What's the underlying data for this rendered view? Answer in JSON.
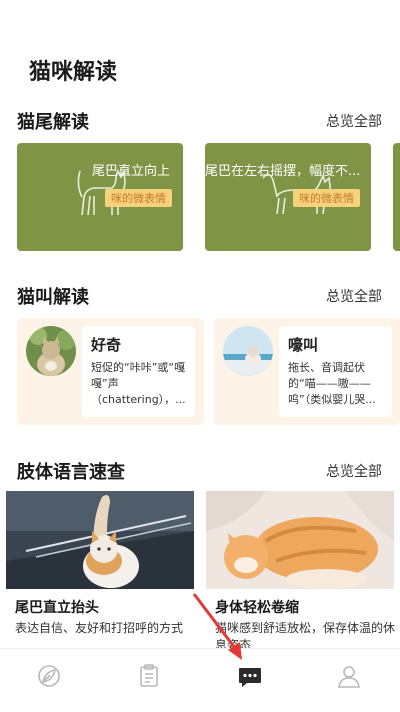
{
  "page_title": "猫咪解读",
  "sections": {
    "tail": {
      "title": "猫尾解读",
      "more": "总览全部"
    },
    "sound": {
      "title": "猫叫解读",
      "more": "总览全部"
    },
    "body": {
      "title": "肢体语言速查",
      "more": "总览全部"
    }
  },
  "tail_cards": [
    {
      "title": "尾巴直立向上",
      "badge": "咪的微表情"
    },
    {
      "title": "尾巴在左右摇摆，幅度不...",
      "badge": "咪的微表情"
    }
  ],
  "sound_cards": [
    {
      "name": "好奇",
      "desc": "短促的“咔咔”或“嘎嘎”声（chattering），..."
    },
    {
      "name": "嚎叫",
      "desc": "拖长、音调起伏的“喵——嗷——呜”（类似婴儿哭..."
    }
  ],
  "body_cards": [
    {
      "title": "尾巴直立抬头",
      "desc": "表达自信、友好和打招呼的方式"
    },
    {
      "title": "身体轻松卷缩",
      "desc": "猫咪感到舒适放松，保存体温的休息姿态"
    }
  ],
  "tabbar": {
    "items": [
      {
        "icon": "leaf-icon",
        "active": false
      },
      {
        "icon": "clipboard-icon",
        "active": false
      },
      {
        "icon": "chat-icon",
        "active": true
      },
      {
        "icon": "user-icon",
        "active": false
      }
    ]
  },
  "colors": {
    "tail_card": "#7f9545",
    "badge_bg": "#f6d27a",
    "sound_card_bg": "#fdf4e7",
    "annotation_arrow": "#e53935"
  }
}
